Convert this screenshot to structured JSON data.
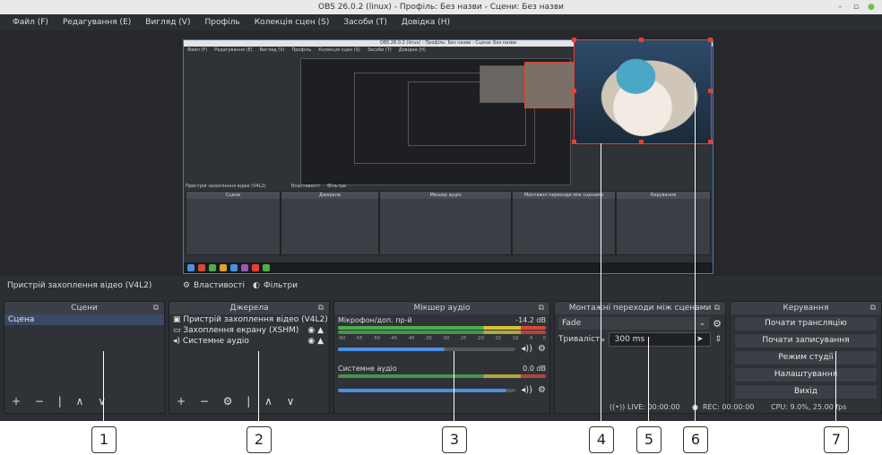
{
  "window": {
    "title": "OBS 26.0.2 (linux) - Профіль: Без назви - Сцени: Без назви"
  },
  "menu": [
    "Файл (F)",
    "Редагування (E)",
    "Вигляд (V)",
    "Профіль",
    "Колекція сцен (S)",
    "Засоби (T)",
    "Довідка (H)"
  ],
  "preview": {
    "nested_source_label": "Пристрій захоплення відео (V4L2)",
    "nested_props": "Властивості",
    "nested_filters": "Фільтри"
  },
  "source_toolbar": {
    "source_name": "Пристрій захоплення відео (V4L2)",
    "properties": "Властивості",
    "filters": "Фільтри"
  },
  "scenes": {
    "title": "Сцени",
    "items": [
      "Сцена"
    ],
    "buttons": "+ − | ∧ ∨"
  },
  "sources": {
    "title": "Джерела",
    "items": [
      "Пристрій захоплення відео (V4L2)",
      "Захоплення екрану (XSHM)",
      "Системне аудіо"
    ],
    "buttons": "+ − ⚙ | ∧ ∨"
  },
  "mixer": {
    "title": "Мікшер аудіо",
    "channels": [
      {
        "name": "Мікрофон/доп. пр-й",
        "level": "-14.2 dB",
        "fader": 0.6
      },
      {
        "name": "Системне аудіо",
        "level": "0.0 dB",
        "fader": 0.95
      }
    ],
    "scale": [
      "-60",
      "-55",
      "-50",
      "-45",
      "-40",
      "-35",
      "-30",
      "-25",
      "-20",
      "-15",
      "-10",
      "-5",
      "0"
    ]
  },
  "transitions": {
    "title": "Монтажні переходи між сценами",
    "selected": "Fade",
    "duration_label": "Тривалість",
    "duration_value": "300 ms"
  },
  "controls": {
    "title": "Керування",
    "buttons": [
      "Почати трансляцію",
      "Почати записування",
      "Режим студії",
      "Налаштування",
      "Вихід"
    ]
  },
  "status": {
    "live": "LIVE: 00:00:00",
    "rec": "REC: 00:00:00",
    "cpu": "CPU: 9.0%, 25.00 fps"
  },
  "callouts": [
    "1",
    "2",
    "3",
    "4",
    "5",
    "6",
    "7"
  ],
  "colors": {
    "accent": "#3b7ad9",
    "selection": "#e64032",
    "meter_green": "#4cae4c",
    "meter_yellow": "#d4c43a",
    "meter_red": "#d44b3a",
    "fader_blue": "#4a90e2"
  }
}
